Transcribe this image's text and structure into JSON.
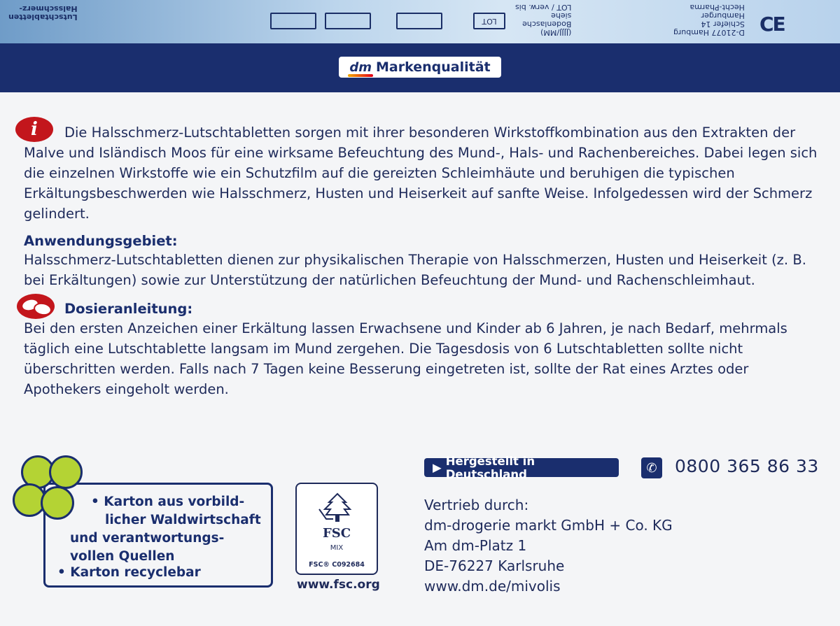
{
  "top_strip": {
    "product_name_lines": [
      "Halsschmerz-",
      "Lutschtabletten"
    ],
    "lot_label": "LOT",
    "lot_note_lines": [
      "LOT / verw. bis",
      "siehe",
      "Bodenlasche",
      "(JJJJ/MM)"
    ],
    "manufacturer_lines": [
      "Hecht-Pharma",
      "Hamburger",
      "Schiefer 14",
      "D-21077 Hamburg"
    ],
    "ce_mark": "CE"
  },
  "brand": {
    "logo": "dm",
    "label": "Markenqualität"
  },
  "description": "Die Halsschmerz-Lutschtabletten sorgen mit ihrer besonderen Wirkstoffkombination aus den Extrakten der Malve und Isländisch Moos für eine wirksame Befeuchtung des Mund-, Hals- und Rachenbereiches. Dabei legen sich die einzelnen Wirkstoffe wie ein Schutzfilm auf die gereizten Schleimhäute und beruhigen die typischen Erkältungsbeschwerden wie Halsschmerz, Husten und Heiserkeit auf sanfte Weise. Infolgedessen wird der Schmerz gelindert.",
  "info_icon_glyph": "i",
  "application": {
    "heading": "Anwendungsgebiet:",
    "text": "Halsschmerz-Lutschtabletten dienen zur physikalischen Therapie von Halsschmerzen, Husten und Heiserkeit (z. B. bei Erkältungen) sowie zur Unterstützung der natürlichen Befeuchtung der Mund- und Rachenschleimhaut."
  },
  "dosage": {
    "heading": "Dosieranleitung:",
    "text": "Bei den ersten Anzeichen einer Erkältung lassen Erwachsene und Kinder ab 6 Jahren, je nach Bedarf, mehrmals täglich eine Lutschtablette langsam im Mund zergehen. Die Tagesdosis von 6 Lutschtabletten sollte nicht überschritten werden. Falls nach 7 Tagen keine Besserung eingetreten ist, sollte der Rat eines Arztes oder Apothekers eingeholt werden."
  },
  "eco": {
    "lines": [
      "• Karton aus vorbild-",
      "licher Waldwirtschaft",
      "und verantwortungs-",
      "vollen Quellen",
      "• Karton recyclebar"
    ]
  },
  "fsc": {
    "logo_text": "FSC",
    "mix": "MIX",
    "code": "FSC® C092684",
    "url": "www.fsc.org"
  },
  "made_in": "Hergestellt in Deutschland",
  "phone": "0800 365 86 33",
  "distributor": {
    "lines": [
      "Vertrieb durch:",
      "dm-drogerie markt GmbH + Co. KG",
      "Am dm-Platz 1",
      "DE-76227 Karlsruhe",
      "www.dm.de/mivolis"
    ]
  },
  "colors": {
    "navy": "#1a2e6e",
    "red": "#c3161c",
    "green": "#b4d334",
    "background": "#f4f5f7"
  }
}
